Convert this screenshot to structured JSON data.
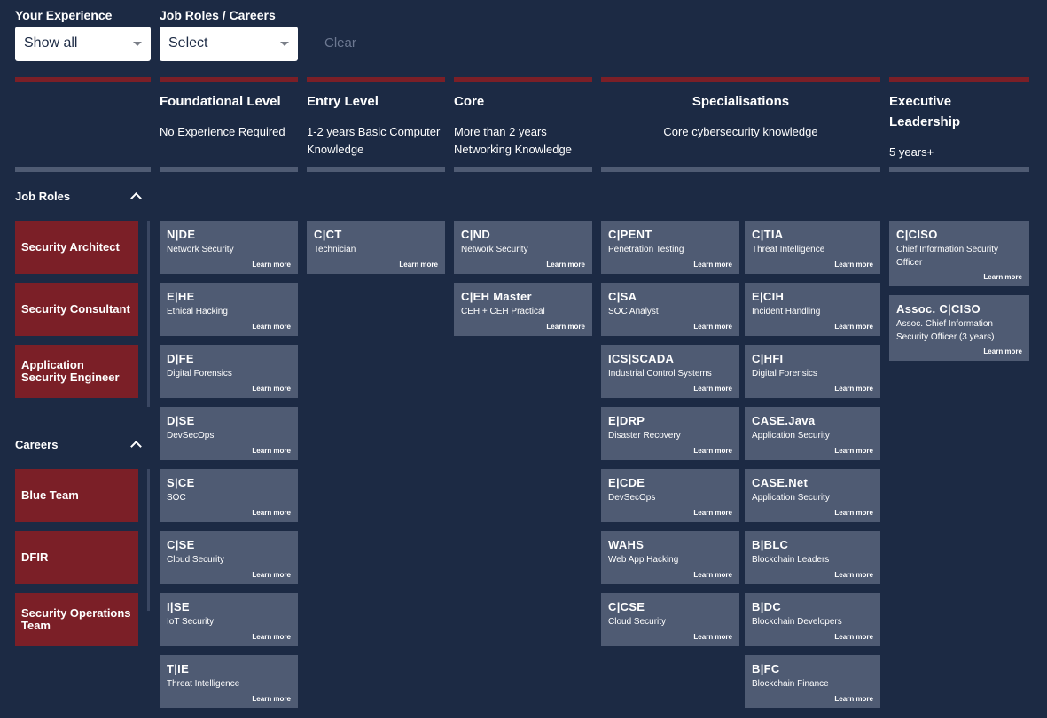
{
  "filters": {
    "experience_label": "Your Experience",
    "experience_value": "Show all",
    "roles_label": "Job Roles / Careers",
    "roles_value": "Select",
    "clear_label": "Clear"
  },
  "columns": [
    {
      "title": "Foundational Level",
      "subtitle": "No Experience Required"
    },
    {
      "title": "Entry Level",
      "subtitle": "1-2 years Basic Computer Knowledge"
    },
    {
      "title": "Core",
      "subtitle": "More than 2 years Networking Knowledge"
    },
    {
      "title": "Specialisations",
      "subtitle": "Core cybersecurity knowledge"
    },
    {
      "title": "Executive Leadership",
      "subtitle": "5 years+"
    }
  ],
  "sidebar": {
    "job_roles_label": "Job Roles",
    "job_roles": [
      "Security Architect",
      "Security Consultant",
      "Application Security Engineer"
    ],
    "careers_label": "Careers",
    "careers": [
      "Blue Team",
      "DFIR",
      "Security Operations Team"
    ]
  },
  "learn_more": "Learn more",
  "cards": {
    "foundational": [
      {
        "code": "N|DE",
        "desc": "Network Security"
      },
      {
        "code": "E|HE",
        "desc": "Ethical Hacking"
      },
      {
        "code": "D|FE",
        "desc": "Digital Forensics"
      },
      {
        "code": "D|SE",
        "desc": "DevSecOps"
      },
      {
        "code": "S|CE",
        "desc": "SOC"
      },
      {
        "code": "C|SE",
        "desc": "Cloud Security"
      },
      {
        "code": "I|SE",
        "desc": "IoT Security"
      },
      {
        "code": "T|IE",
        "desc": "Threat Intelligence"
      }
    ],
    "entry": [
      {
        "code": "C|CT",
        "desc": "Technician"
      }
    ],
    "core": [
      {
        "code": "C|ND",
        "desc": "Network Security"
      },
      {
        "code": "C|EH Master",
        "desc": "CEH + CEH Practical"
      }
    ],
    "spec_left": [
      {
        "code": "C|PENT",
        "desc": "Penetration Testing"
      },
      {
        "code": "C|SA",
        "desc": "SOC Analyst"
      },
      {
        "code": "ICS|SCADA",
        "desc": "Industrial Control Systems"
      },
      {
        "code": "E|DRP",
        "desc": "Disaster Recovery"
      },
      {
        "code": "E|CDE",
        "desc": "DevSecOps"
      },
      {
        "code": "WAHS",
        "desc": "Web App Hacking"
      },
      {
        "code": "C|CSE",
        "desc": "Cloud Security"
      }
    ],
    "spec_right": [
      {
        "code": "C|TIA",
        "desc": "Threat Intelligence"
      },
      {
        "code": "E|CIH",
        "desc": "Incident Handling"
      },
      {
        "code": "C|HFI",
        "desc": "Digital Forensics"
      },
      {
        "code": "CASE.Java",
        "desc": "Application Security"
      },
      {
        "code": "CASE.Net",
        "desc": "Application Security"
      },
      {
        "code": "B|BLC",
        "desc": "Blockchain Leaders"
      },
      {
        "code": "B|DC",
        "desc": "Blockchain Developers"
      },
      {
        "code": "B|FC",
        "desc": "Blockchain Finance"
      }
    ],
    "executive": [
      {
        "code": "C|CISO",
        "desc": "Chief Information Security Officer"
      },
      {
        "code": "Assoc. C|CISO",
        "desc": "Assoc. Chief Information Security Officer (3 years)"
      }
    ]
  }
}
